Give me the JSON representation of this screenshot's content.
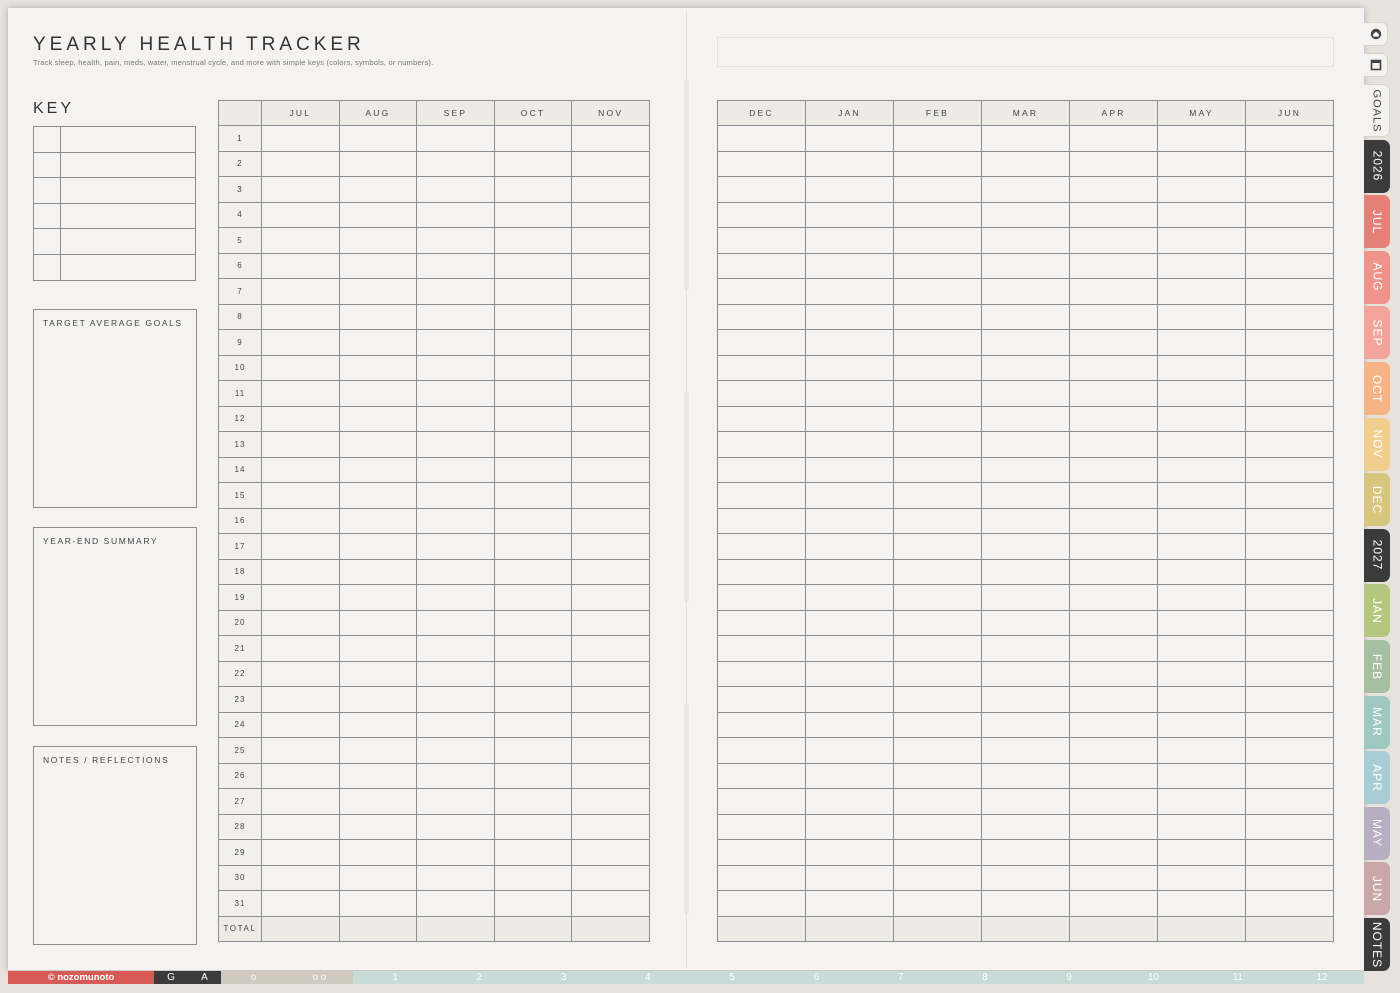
{
  "header": {
    "title": "YEARLY HEALTH TRACKER",
    "subtitle": "Track sleep, health, pain, meds, water, menstrual cycle, and more with simple keys (colors, symbols, or numbers)."
  },
  "sidebar": {
    "key_title": "KEY",
    "boxes": [
      {
        "label": "TARGET AVERAGE GOALS"
      },
      {
        "label": "YEAR-END SUMMARY"
      },
      {
        "label": "NOTES / REFLECTIONS"
      }
    ]
  },
  "tracker": {
    "left_months": [
      "JUL",
      "AUG",
      "SEP",
      "OCT",
      "NOV"
    ],
    "right_months": [
      "DEC",
      "JAN",
      "FEB",
      "MAR",
      "APR",
      "MAY",
      "JUN"
    ],
    "days": [
      "1",
      "2",
      "3",
      "4",
      "5",
      "6",
      "7",
      "8",
      "9",
      "10",
      "11",
      "12",
      "13",
      "14",
      "15",
      "16",
      "17",
      "18",
      "19",
      "20",
      "21",
      "22",
      "23",
      "24",
      "25",
      "26",
      "27",
      "28",
      "29",
      "30",
      "31"
    ],
    "total_label": "TOTAL"
  },
  "side_tabs": [
    {
      "label": "GOALS",
      "color": "#f4f3f1"
    },
    {
      "label": "2026",
      "color": "#3b3b3b"
    },
    {
      "label": "JUL",
      "color": "#e58078"
    },
    {
      "label": "AUG",
      "color": "#f0938a"
    },
    {
      "label": "SEP",
      "color": "#f4a39a"
    },
    {
      "label": "OCT",
      "color": "#f6b486"
    },
    {
      "label": "NOV",
      "color": "#efce8e"
    },
    {
      "label": "DEC",
      "color": "#d8c57e"
    },
    {
      "label": "2027",
      "color": "#3b3b3b"
    },
    {
      "label": "JAN",
      "color": "#b5c67e"
    },
    {
      "label": "FEB",
      "color": "#a6bfa0"
    },
    {
      "label": "MAR",
      "color": "#9fc8c3"
    },
    {
      "label": "APR",
      "color": "#a9cdd6"
    },
    {
      "label": "MAY",
      "color": "#b7aec2"
    },
    {
      "label": "JUN",
      "color": "#c9a7a8"
    },
    {
      "label": "NOTES",
      "color": "#3b3b3b"
    }
  ],
  "bottom_nav": {
    "brand": "© nozomunoto",
    "items": [
      "G",
      "A",
      "o",
      "o o",
      "1",
      "2",
      "3",
      "4",
      "5",
      "6",
      "7",
      "8",
      "9",
      "10",
      "11",
      "12"
    ]
  }
}
